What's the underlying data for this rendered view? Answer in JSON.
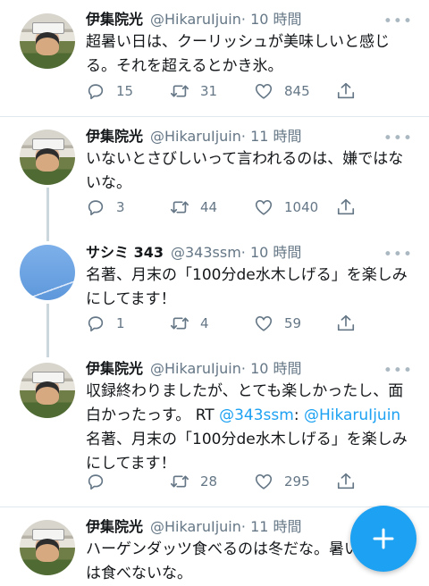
{
  "tweets": [
    {
      "name": "伊集院光",
      "handle": "@HikaruIjuin",
      "time": "· 10 時間",
      "lines": [
        "超暑い日は、クーリッシュが美味しいと感じ",
        "る。それを超えるとかき氷。"
      ],
      "replies": "15",
      "retweets": "31",
      "likes": "845"
    },
    {
      "name": "伊集院光",
      "handle": "@HikaruIjuin",
      "time": "· 11 時間",
      "lines": [
        "いないとさびしいって言われるのは、嫌ではな",
        "いな。"
      ],
      "replies": "3",
      "retweets": "44",
      "likes": "1040"
    },
    {
      "name": "サシミ 343",
      "handle": "@343ssm",
      "time": "· 10 時間",
      "lines": [
        "名著、月末の「100分de水木しげる」を楽しみ",
        "にしてます！"
      ],
      "replies": "1",
      "retweets": "4",
      "likes": "59"
    },
    {
      "name": "伊集院光",
      "handle": "@HikaruIjuin",
      "time": "· 10 時間",
      "line1": "収録終わりましたが、とても楽しかったし、面",
      "line2_prefix": "白かったっす。 RT ",
      "line2_mention1": "@343ssm",
      "line2_colon": ": ",
      "line2_mention2": "@HikaruIjuin",
      "line3": "名著、月末の「100分de水木しげる」を楽しみ",
      "line4": "にしてます！",
      "replies": "",
      "retweets": "28",
      "likes": "295"
    },
    {
      "name": "伊集院光",
      "handle": "@HikaruIjuin",
      "time": "· 11 時間",
      "lines": [
        "ハーゲンダッツ食べるのは冬だな。暑い",
        "は食べないな。"
      ]
    }
  ],
  "more_glyph": "•••",
  "icons": {
    "reply": "reply-icon",
    "retweet": "retweet-icon",
    "like": "heart-icon",
    "share": "share-icon",
    "compose": "plus-icon"
  },
  "colors": {
    "accent": "#1da1f2",
    "text": "#14171a",
    "muted": "#657786",
    "divider": "#e1e8ed"
  }
}
